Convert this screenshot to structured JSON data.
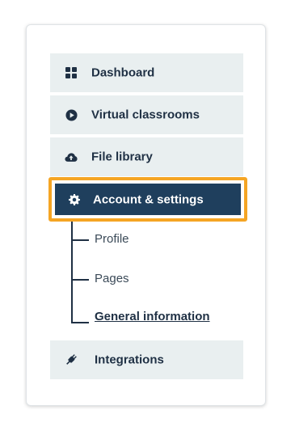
{
  "nav": {
    "items": [
      {
        "label": "Dashboard",
        "icon": "grid-icon"
      },
      {
        "label": "Virtual classrooms",
        "icon": "play-circle-icon"
      },
      {
        "label": "File library",
        "icon": "cloud-upload-icon"
      }
    ],
    "active": {
      "label": "Account & settings",
      "icon": "gear-icon"
    },
    "subitems": [
      {
        "label": "Profile"
      },
      {
        "label": "Pages"
      },
      {
        "label": "General information",
        "current": true
      }
    ],
    "integrations": {
      "label": "Integrations",
      "icon": "plug-icon"
    }
  },
  "colors": {
    "item_bg": "#e9eff0",
    "active_bg": "#1f3f5d",
    "highlight_border": "#f5a524",
    "text_dark": "#1f3044"
  }
}
